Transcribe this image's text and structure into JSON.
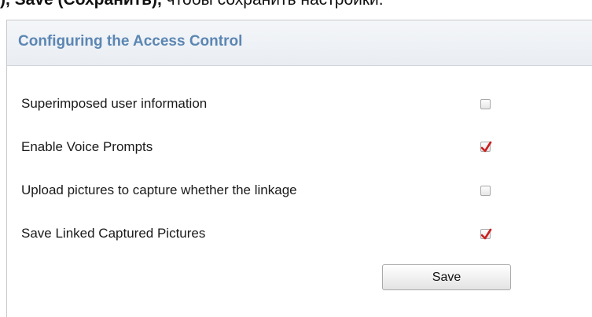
{
  "top_strip": {
    "text_bold": "), Save (Сохранить),",
    "text_normal": " чтобы сохранить настройки."
  },
  "panel": {
    "title": "Configuring the Access Control",
    "options": [
      {
        "label": "Superimposed user information",
        "checked": false
      },
      {
        "label": "Enable Voice Prompts",
        "checked": true
      },
      {
        "label": "Upload pictures to capture whether the linkage",
        "checked": false
      },
      {
        "label": "Save Linked Captured Pictures",
        "checked": true
      }
    ],
    "save_label": "Save"
  },
  "colors": {
    "title": "#5b86b3",
    "checkmark": "#cc1f1f"
  }
}
